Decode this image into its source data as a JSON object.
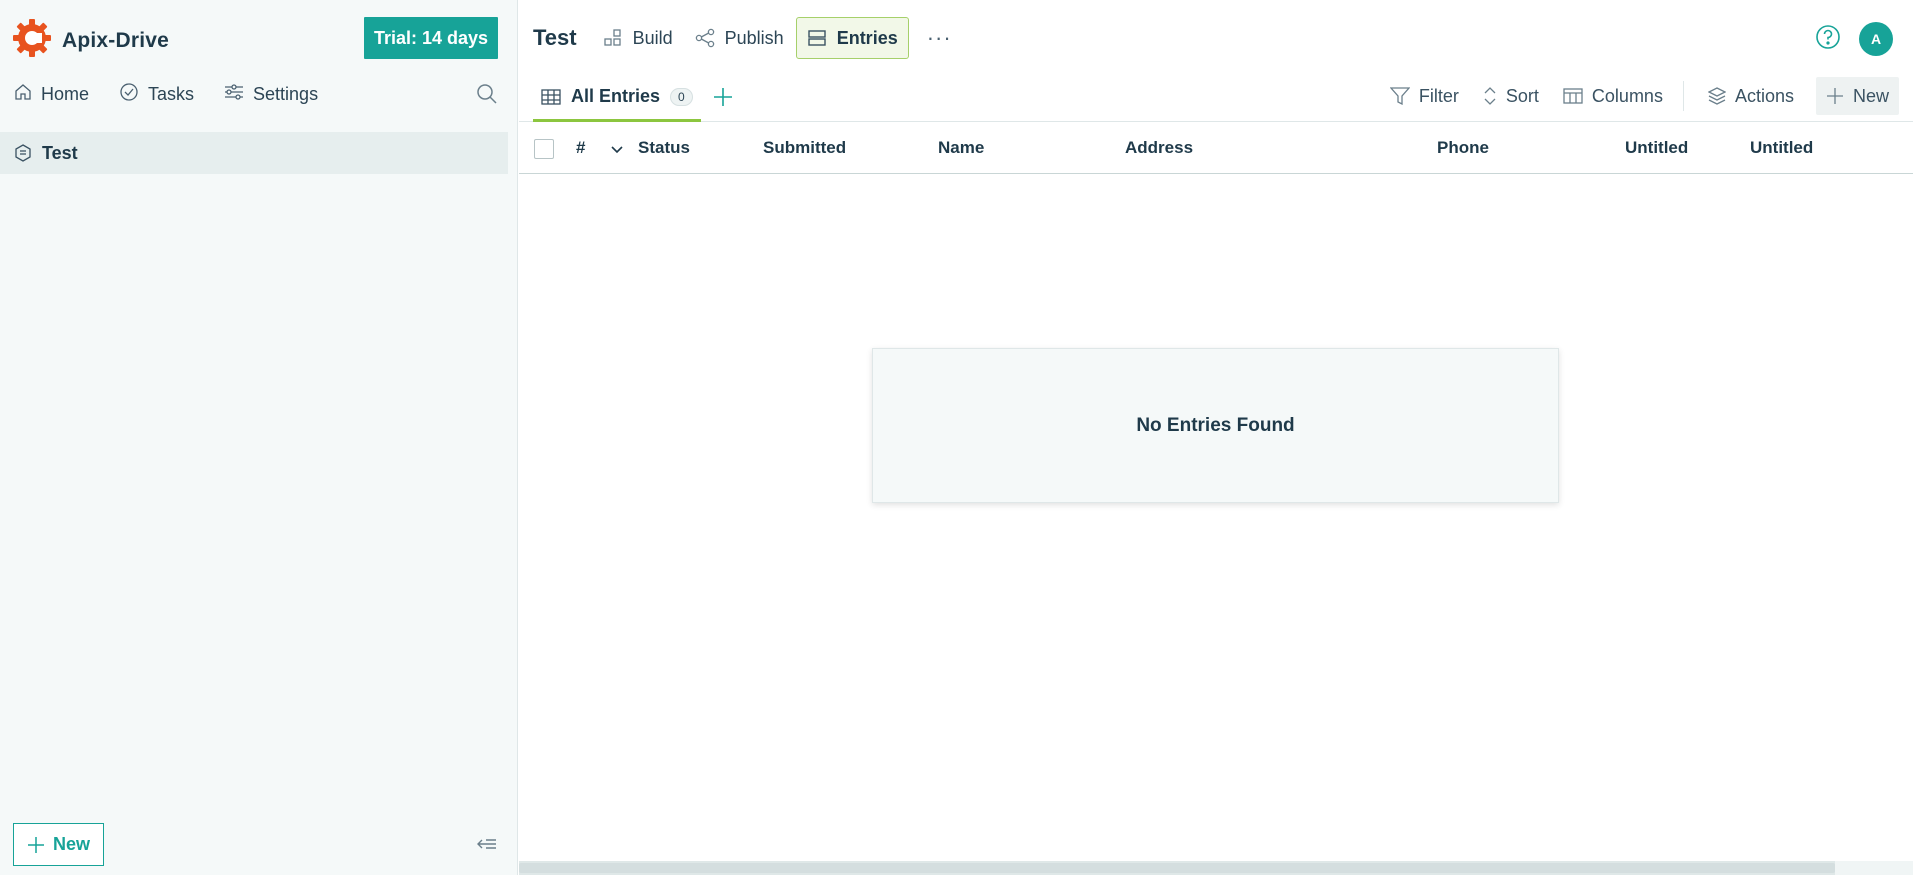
{
  "brand": {
    "name": "Apix-Drive",
    "logo_color": "#e8531f"
  },
  "trial": {
    "label": "Trial: 14 days"
  },
  "sidebar": {
    "nav": [
      {
        "label": "Home",
        "icon": "home-icon"
      },
      {
        "label": "Tasks",
        "icon": "check-circle-icon"
      },
      {
        "label": "Settings",
        "icon": "sliders-icon"
      }
    ],
    "projects": [
      {
        "label": "Test",
        "icon": "form-icon"
      }
    ],
    "new_label": "New"
  },
  "header": {
    "title": "Test",
    "tabs": [
      {
        "label": "Build",
        "icon": "build-icon",
        "active": false
      },
      {
        "label": "Publish",
        "icon": "share-icon",
        "active": false
      },
      {
        "label": "Entries",
        "icon": "entries-icon",
        "active": true
      }
    ],
    "more": "···",
    "avatar_initial": "A"
  },
  "views": {
    "active_label": "All Entries",
    "active_count": "0",
    "tools": [
      {
        "label": "Filter",
        "icon": "filter-icon"
      },
      {
        "label": "Sort",
        "icon": "sort-icon"
      },
      {
        "label": "Columns",
        "icon": "columns-icon"
      },
      {
        "label": "Actions",
        "icon": "layers-icon"
      },
      {
        "label": "New",
        "icon": "plus-icon"
      }
    ]
  },
  "table": {
    "columns": [
      "#",
      "Status",
      "Submitted",
      "Name",
      "Address",
      "Phone",
      "Untitled",
      "Untitled"
    ],
    "empty_message": "No Entries Found"
  },
  "colors": {
    "accent": "#17a398",
    "active_tab_border": "#8cc63f"
  }
}
